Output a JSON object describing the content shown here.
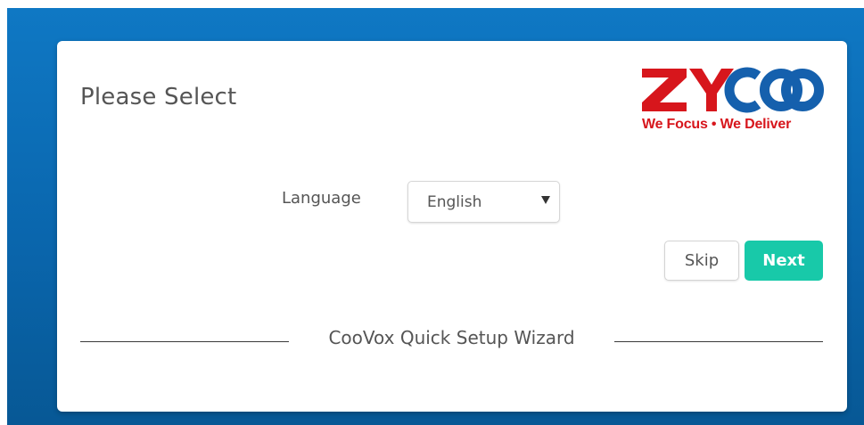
{
  "header": {
    "title": "Please Select"
  },
  "logo": {
    "brand": "ZYCOO",
    "tagline": "We Focus • We Deliver",
    "colors": {
      "red": "#d7161c",
      "blue": "#1560ad"
    }
  },
  "form": {
    "language_label": "Language",
    "language_value": "English"
  },
  "buttons": {
    "skip_label": "Skip",
    "next_label": "Next"
  },
  "footer": {
    "wizard_name": "CooVox Quick Setup Wizard"
  },
  "colors": {
    "background": "#0a66ad",
    "accent": "#18c9a9"
  }
}
